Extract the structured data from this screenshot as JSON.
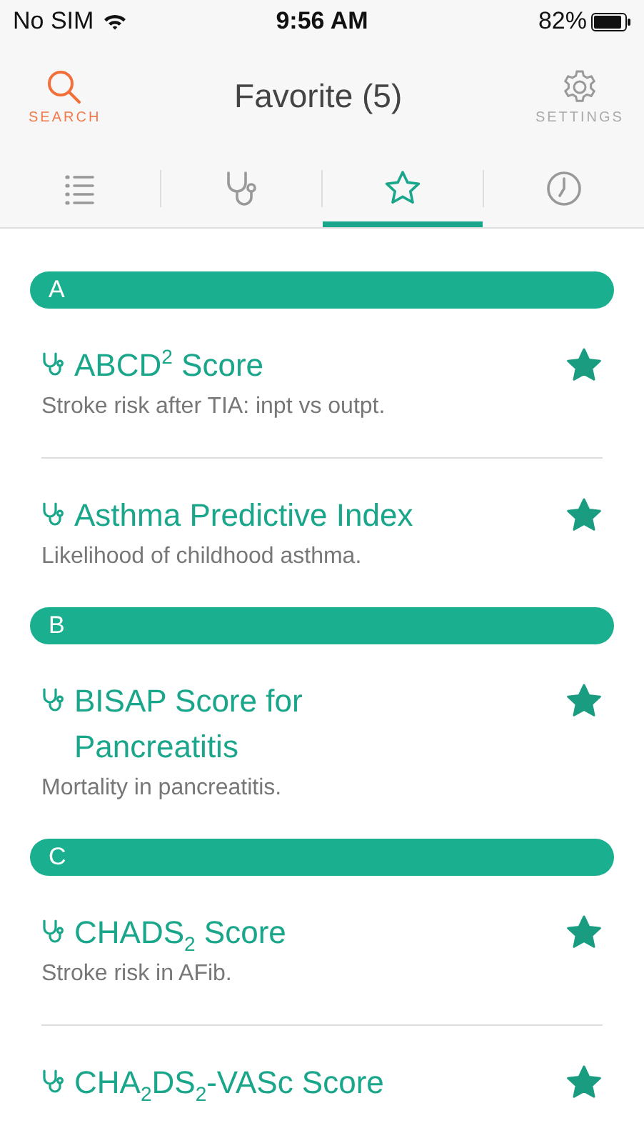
{
  "status_bar": {
    "carrier": "No SIM",
    "time": "9:56 AM",
    "battery": "82%"
  },
  "header": {
    "title": "Favorite (5)",
    "left_button": {
      "label": "SEARCH"
    },
    "right_button": {
      "label": "SETTINGS"
    }
  },
  "tabs": [
    {
      "kind": "list",
      "selected": false
    },
    {
      "kind": "stethoscope",
      "selected": false
    },
    {
      "kind": "star",
      "selected": true
    },
    {
      "kind": "clock",
      "selected": false
    }
  ],
  "sections": [
    {
      "letter": "A",
      "items": [
        {
          "title": "ABCD$^{2}$ Score",
          "subtitle": "Stroke risk after TIA: inpt vs outpt.",
          "favorite": true
        },
        {
          "title": "Asthma Predictive Index",
          "subtitle": "Likelihood of childhood asthma.",
          "favorite": true
        }
      ]
    },
    {
      "letter": "B",
      "items": [
        {
          "title": "BISAP Score for Pancreatitis",
          "subtitle": "Mortality in pancreatitis.",
          "favorite": true
        }
      ]
    },
    {
      "letter": "C",
      "items": [
        {
          "title": "CHADS$_{2}$ Score",
          "subtitle": "Stroke risk in AFib.",
          "favorite": true
        },
        {
          "title": "CHA$_{2}$DS$_{2}$-VASc Score",
          "favorite": true
        }
      ]
    }
  ]
}
